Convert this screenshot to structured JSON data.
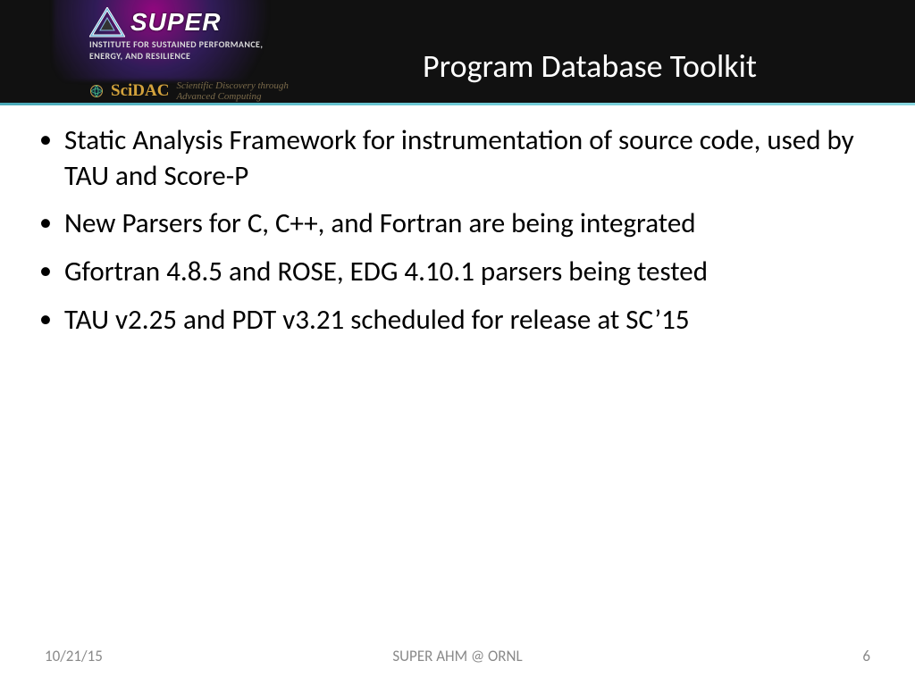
{
  "header": {
    "logo_text": "SUPER",
    "institute_line1": "INSTITUTE FOR SUSTAINED PERFORMANCE,",
    "institute_line2": "ENERGY, AND RESILIENCE",
    "scidac_label": "SciDAC",
    "scidac_sub1": "Scientific Discovery through",
    "scidac_sub2": "Advanced Computing",
    "title": "Program Database Toolkit"
  },
  "bullets": [
    "Static Analysis Framework for instrumentation of source code, used by TAU and Score-P",
    "New Parsers for C, C++, and Fortran are being integrated",
    "Gfortran 4.8.5 and ROSE, EDG 4.10.1 parsers being tested",
    "TAU v2.25 and PDT v3.21 scheduled for release at SC’15"
  ],
  "footer": {
    "date": "10/21/15",
    "event": "SUPER AHM @ ORNL",
    "page": "6"
  }
}
